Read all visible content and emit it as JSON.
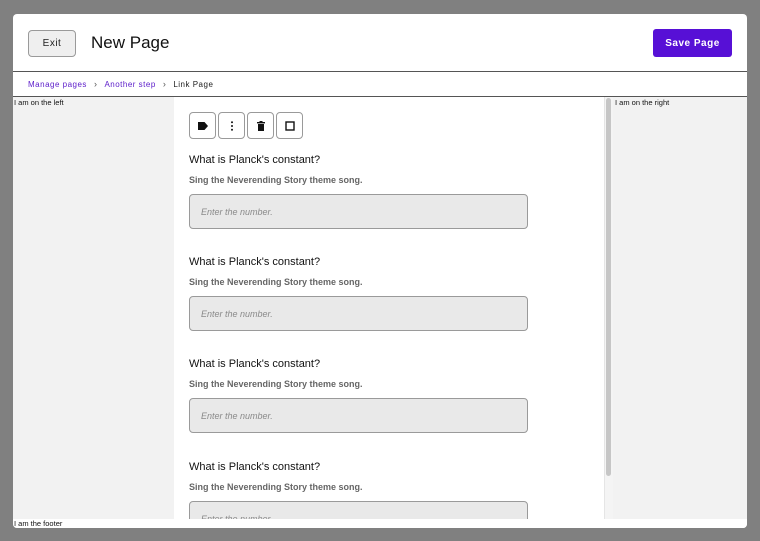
{
  "header": {
    "exit_label": "Exit",
    "title": "New Page",
    "save_label": "Save Page"
  },
  "breadcrumb": {
    "items": [
      {
        "label": "Manage pages"
      },
      {
        "label": "Another step"
      },
      {
        "label": "Link Page"
      }
    ]
  },
  "left_panel": {
    "text": "I am on the left"
  },
  "right_panel": {
    "text": "I am on the right"
  },
  "footer": {
    "text": "I am the footer"
  },
  "toolbar": {
    "icons": [
      "tag-icon",
      "more-vertical-icon",
      "trash-icon",
      "square-icon"
    ]
  },
  "questions": [
    {
      "title": "What is Planck's constant?",
      "description": "Sing the Neverending Story theme song.",
      "placeholder": "Enter the number."
    },
    {
      "title": "What is Planck's constant?",
      "description": "Sing the Neverending Story theme song.",
      "placeholder": "Enter the number."
    },
    {
      "title": "What is Planck's constant?",
      "description": "Sing the Neverending Story theme song.",
      "placeholder": "Enter the number."
    },
    {
      "title": "What is Planck's constant?",
      "description": "Sing the Neverending Story theme song.",
      "placeholder": "Enter the number."
    }
  ],
  "colors": {
    "accent": "#5710d6",
    "link": "#5a1ac9",
    "backdrop": "#808080",
    "panel": "#f2f2f2"
  }
}
